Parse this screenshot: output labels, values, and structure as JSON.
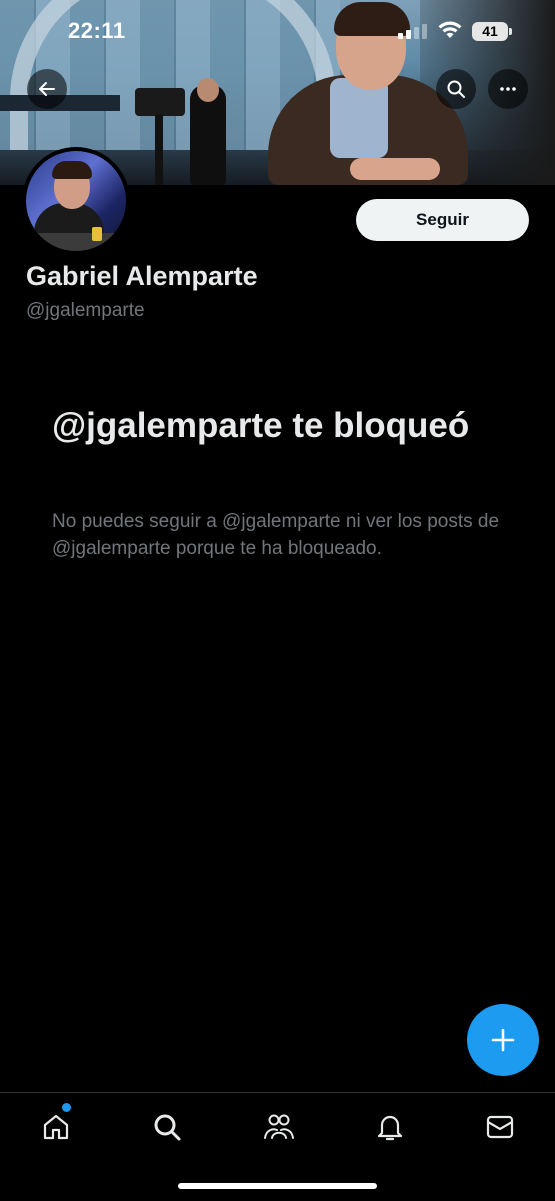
{
  "status_bar": {
    "time": "22:11",
    "battery": "41"
  },
  "header": {
    "back_icon": "arrow-left-icon",
    "search_icon": "search-icon",
    "more_icon": "more-horizontal-icon"
  },
  "profile": {
    "display_name": "Gabriel Alemparte",
    "handle": "@jgalemparte",
    "follow_label": "Seguir"
  },
  "blocked_notice": {
    "title": "@jgalemparte te bloqueó",
    "description": "No puedes seguir a @jgalemparte ni ver los posts de @jgalemparte porque te ha bloqueado."
  },
  "fab": {
    "icon": "plus-icon"
  },
  "bottom_nav": {
    "items": [
      {
        "name": "home",
        "icon": "home-icon",
        "has_dot": true
      },
      {
        "name": "search",
        "icon": "search-icon"
      },
      {
        "name": "communities",
        "icon": "people-icon"
      },
      {
        "name": "notifications",
        "icon": "bell-icon"
      },
      {
        "name": "messages",
        "icon": "mail-icon"
      }
    ]
  },
  "colors": {
    "accent": "#1d9bf0",
    "background": "#000000",
    "primary_text": "#e7e9ea",
    "secondary_text": "#71767b"
  }
}
